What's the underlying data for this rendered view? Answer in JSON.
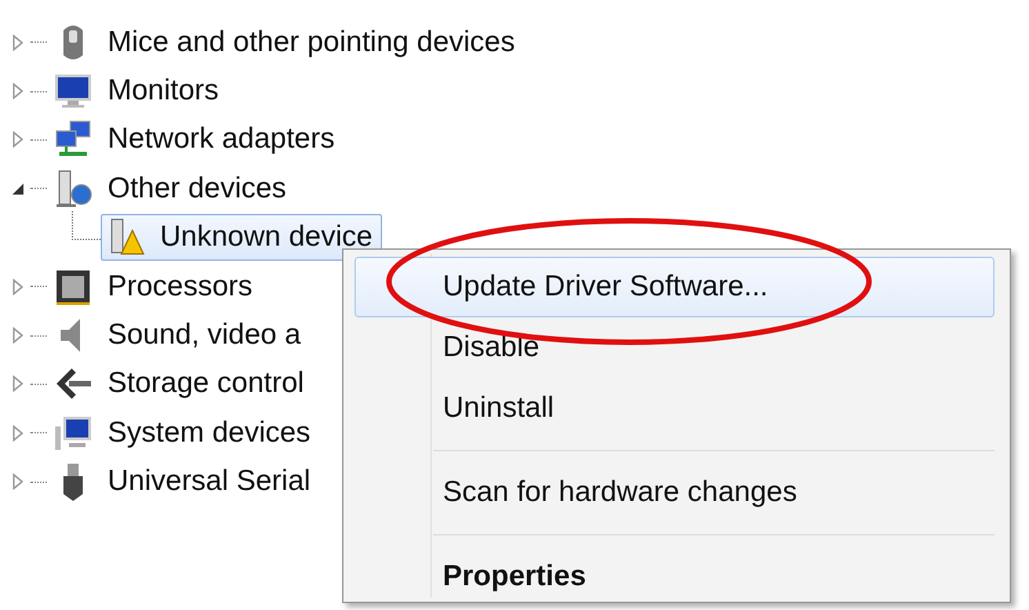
{
  "tree": [
    {
      "label": "Mice and other pointing devices",
      "expanded": false
    },
    {
      "label": "Monitors",
      "expanded": false
    },
    {
      "label": "Network adapters",
      "expanded": false
    },
    {
      "label": "Other devices",
      "expanded": true,
      "children": [
        {
          "label": "Unknown device",
          "selected": true
        }
      ]
    },
    {
      "label": "Processors",
      "expanded": false
    },
    {
      "label": "Sound, video a",
      "expanded": false
    },
    {
      "label": "Storage control",
      "expanded": false
    },
    {
      "label": "System devices",
      "expanded": false
    },
    {
      "label": "Universal Serial",
      "expanded": false
    }
  ],
  "context_menu": [
    {
      "kind": "item",
      "label": "Update Driver Software...",
      "selected": true,
      "default": false
    },
    {
      "kind": "item",
      "label": "Disable",
      "selected": false,
      "default": false
    },
    {
      "kind": "item",
      "label": "Uninstall",
      "selected": false,
      "default": false
    },
    {
      "kind": "separator"
    },
    {
      "kind": "item",
      "label": "Scan for hardware changes",
      "selected": false,
      "default": false
    },
    {
      "kind": "separator"
    },
    {
      "kind": "item",
      "label": "Properties",
      "selected": false,
      "default": true
    }
  ]
}
